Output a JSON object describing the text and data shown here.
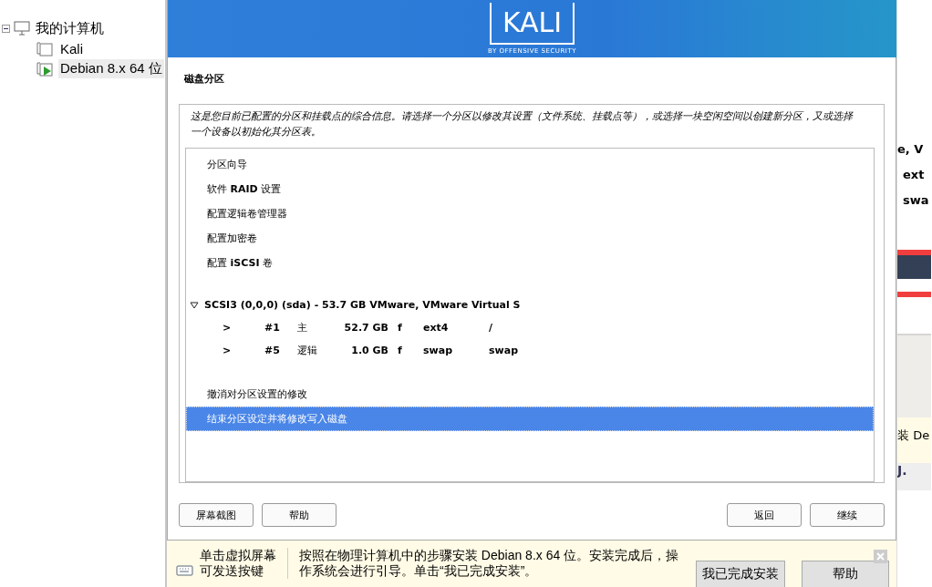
{
  "sidebar": {
    "tree": [
      {
        "label": "我的计算机",
        "expanded": true,
        "children": [
          {
            "label": "Kali",
            "selected": false,
            "running": false
          },
          {
            "label": "Debian 8.x 64 位",
            "selected": true,
            "running": true
          }
        ]
      }
    ]
  },
  "installer": {
    "banner": {
      "logo": "KALI",
      "tagline": "BY OFFENSIVE SECURITY"
    },
    "title": "磁盘分区",
    "description": "这是您目前已配置的分区和挂载点的综合信息。请选择一个分区以修改其设置（文件系统、挂载点等），或选择一块空闲空间以创建新分区，又或选择一个设备以初始化其分区表。",
    "tools": [
      {
        "label": "分区向导",
        "selected": false
      },
      {
        "label": "软件 **RAID** 设置",
        "selected": false
      },
      {
        "label": "配置逻辑卷管理器",
        "selected": false
      },
      {
        "label": "配置加密卷",
        "selected": false
      },
      {
        "label": "配置 **iSCSI** 卷",
        "selected": false
      }
    ],
    "disk": {
      "label": "SCSI3 (0,0,0) (sda) - 53.7 GB VMware, VMware Virtual S",
      "expanded": true,
      "partitions": [
        {
          "marker": ">",
          "number": "#1",
          "type": "主",
          "size": "52.7 GB",
          "flag": "f",
          "fs": "ext4",
          "mount": "/"
        },
        {
          "marker": ">",
          "number": "#5",
          "type": "逻辑",
          "size": "1.0 GB",
          "flag": "f",
          "fs": "swap",
          "mount": "swap"
        }
      ]
    },
    "actions": [
      {
        "label": "撤消对分区设置的修改",
        "selected": false
      },
      {
        "label": "结束分区设定并将修改写入磁盘",
        "selected": true
      }
    ],
    "left_buttons": [
      "屏幕截图",
      "帮助"
    ],
    "right_buttons": [
      "返回",
      "继续"
    ]
  },
  "hint_bar": {
    "hint_lines": [
      "单击虚拟屏幕",
      "可发送按键"
    ],
    "message": "按照在物理计算机中的步骤安装 Debian 8.x 64 位。安装完成后，操作系统会进行引导。单击“我已完成安装”。",
    "buttons": [
      "我已完成安装",
      "帮助"
    ]
  },
  "background_window": {
    "texts": [
      "e, V",
      "ext",
      "swa"
    ],
    "footer_texts": [
      "装 De",
      "J."
    ]
  }
}
